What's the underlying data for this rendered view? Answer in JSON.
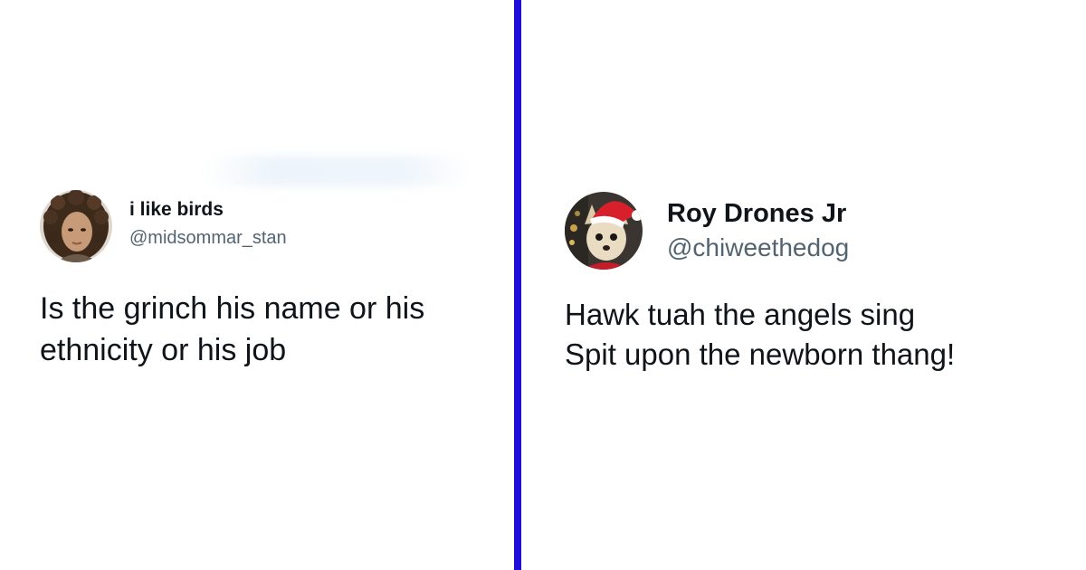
{
  "tweets": [
    {
      "display_name": "i like birds",
      "handle": "@midsommar_stan",
      "text": "Is the grinch his name or his\nethnicity or his job",
      "avatar": "curly-haired-person-avatar"
    },
    {
      "display_name": "Roy Drones Jr",
      "handle": "@chiweethedog",
      "text": "Hawk tuah the angels sing\nSpit upon the newborn thang!",
      "avatar": "chihuahua-santa-hat-avatar"
    }
  ],
  "colors": {
    "divider": "#1f0fd6",
    "name_text": "#0f1419",
    "handle_text": "#536471",
    "background": "#ffffff"
  }
}
